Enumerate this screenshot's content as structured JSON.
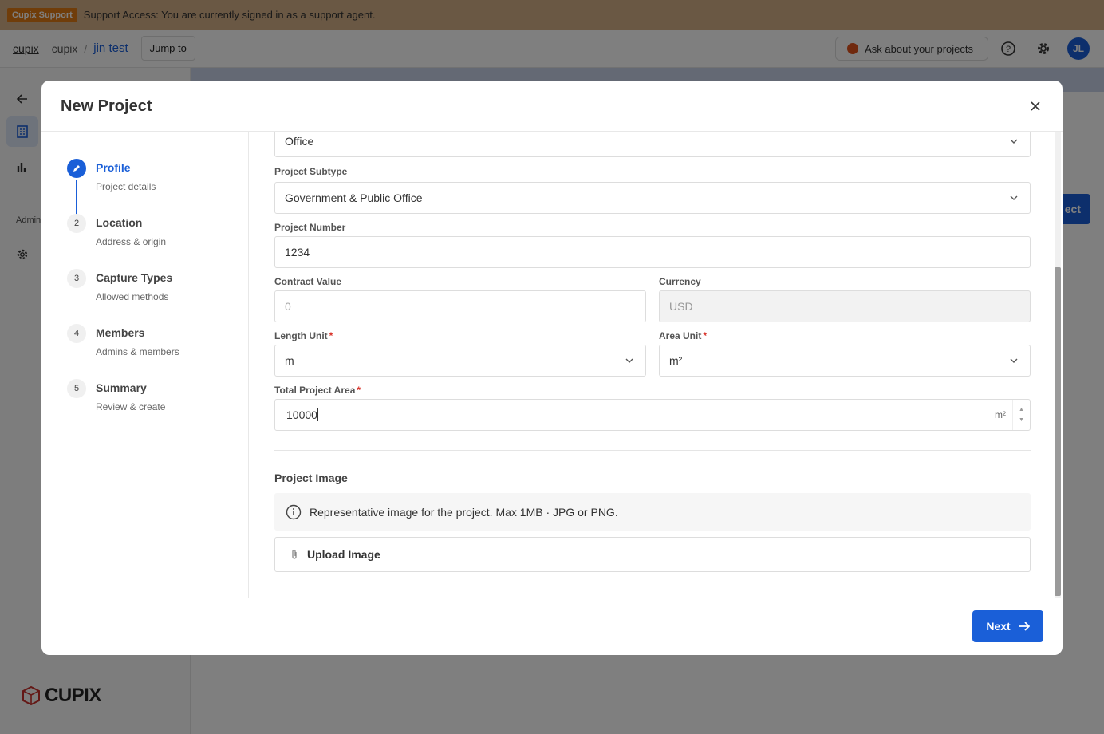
{
  "banner": {
    "badge": "Cupix Support",
    "message": "Support Access: You are currently signed in as a support agent."
  },
  "breadcrumb": {
    "home": "cupix",
    "org": "cupix",
    "separator": "/",
    "project": "jin test"
  },
  "topbar": {
    "jump_label": "Jump to",
    "ask_label": "Ask about your projects",
    "avatar_initials": "JL"
  },
  "sidebar": {
    "admin_label": "Admin",
    "logo_text": "CUPIX"
  },
  "background": {
    "button_fragment": "ect"
  },
  "modal": {
    "title": "New Project",
    "steps": [
      {
        "num": "",
        "title": "Profile",
        "subtitle": "Project details",
        "active": true
      },
      {
        "num": "2",
        "title": "Location",
        "subtitle": "Address & origin"
      },
      {
        "num": "3",
        "title": "Capture Types",
        "subtitle": "Allowed methods"
      },
      {
        "num": "4",
        "title": "Members",
        "subtitle": "Admins & members"
      },
      {
        "num": "5",
        "title": "Summary",
        "subtitle": "Review & create"
      }
    ],
    "form": {
      "project_type_value": "Office",
      "project_subtype_label": "Project Subtype",
      "project_subtype_value": "Government & Public Office",
      "project_number_label": "Project Number",
      "project_number_value": "1234",
      "contract_value_label": "Contract Value",
      "contract_value_placeholder": "0",
      "currency_label": "Currency",
      "currency_value": "USD",
      "length_unit_label": "Length Unit",
      "length_unit_value": "m",
      "area_unit_label": "Area Unit",
      "area_unit_value": "m²",
      "total_area_label": "Total Project Area",
      "total_area_value": "10000",
      "total_area_unit": "m²",
      "required_mark": "*"
    },
    "image_section": {
      "title": "Project Image",
      "info": "Representative image for the project. Max 1MB · JPG or PNG.",
      "upload_label": "Upload Image"
    },
    "next_label": "Next"
  },
  "colors": {
    "accent": "#1a5fd8",
    "banner": "#d4b088",
    "badge": "#e07b14",
    "required": "#d9342b"
  }
}
